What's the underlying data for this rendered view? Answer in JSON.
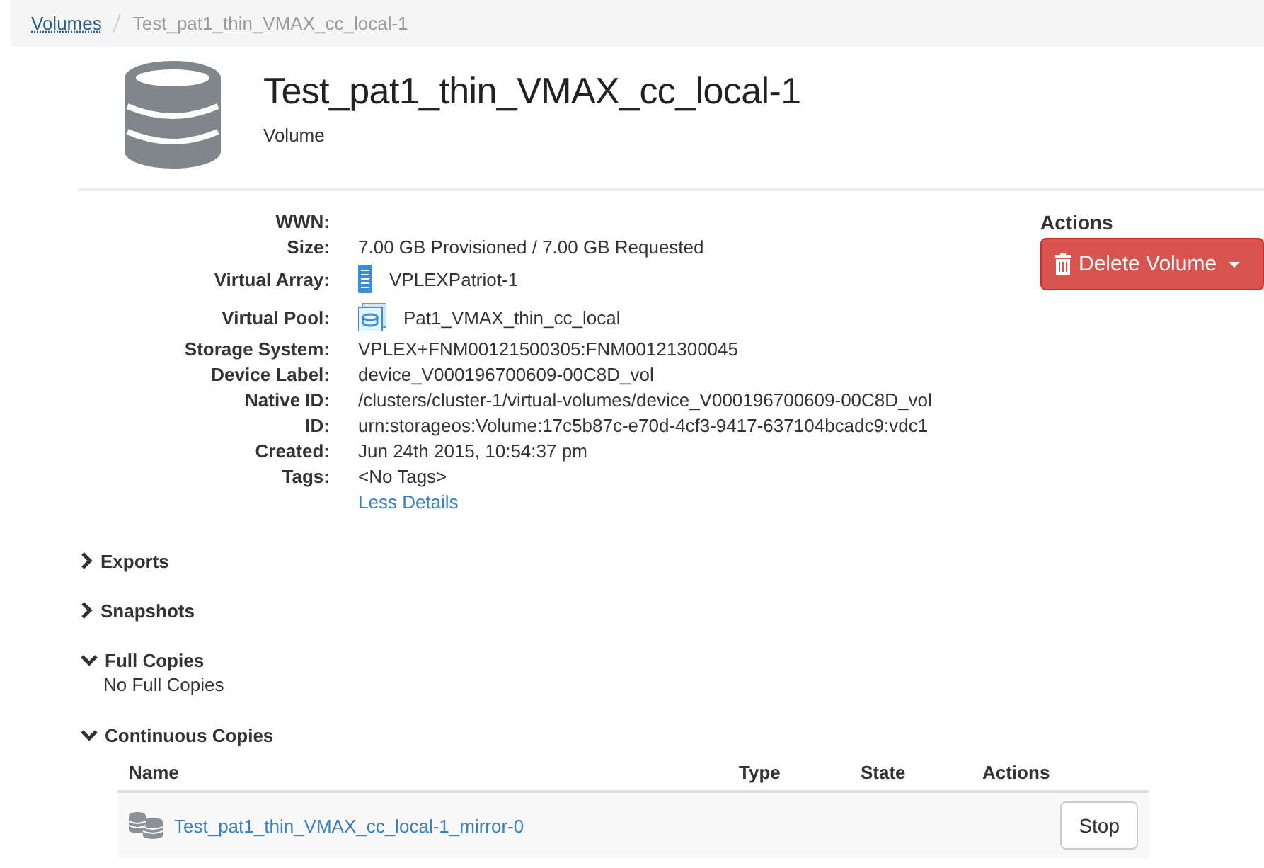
{
  "breadcrumb": [
    {
      "label": "Volumes",
      "kind": "link"
    },
    {
      "label": "Test_pat1_thin_VMAX_cc_local-1",
      "kind": "current"
    }
  ],
  "header": {
    "title": "Test_pat1_thin_VMAX_cc_local-1",
    "subtitle": "Volume"
  },
  "details": [
    {
      "label": "WWN:",
      "kind": "text"
    },
    {
      "label": "Size:",
      "value": "7.00 GB Provisioned / 7.00 GB Requested",
      "kind": "text"
    },
    {
      "label": "Virtual Array:",
      "value": "VPLEXPatriot-1",
      "kind": "array"
    },
    {
      "label": "Virtual Pool:",
      "value": "Pat1_VMAX_thin_cc_local",
      "kind": "pool"
    },
    {
      "label": "Storage System:",
      "value": "VPLEX+FNM00121500305:FNM00121300045",
      "kind": "text"
    },
    {
      "label": "Device Label:",
      "value": "device_V000196700609-00C8D_vol",
      "kind": "text"
    },
    {
      "label": "Native ID:",
      "value": "/clusters/cluster-1/virtual-volumes/device_V000196700609-00C8D_vol",
      "kind": "text"
    },
    {
      "label": "ID:",
      "value": "urn:storageos:Volume:17c5b87c-e70d-4cf3-9417-637104bcadc9:vdc1",
      "kind": "text"
    },
    {
      "label": "Created:",
      "value": "Jun 24th 2015, 10:54:37 pm",
      "kind": "text"
    },
    {
      "label": "Tags:",
      "value": "<No Tags>",
      "kind": "text"
    }
  ],
  "details_toggle": "Less Details",
  "actions": {
    "title": "Actions",
    "button": "Delete Volume"
  },
  "sections": [
    {
      "title": "Exports",
      "expanded": false
    },
    {
      "title": "Snapshots",
      "expanded": false
    },
    {
      "title": "Full Copies",
      "expanded": true,
      "empty_text": "No Full Copies"
    },
    {
      "title": "Continuous Copies",
      "expanded": true,
      "table": {
        "columns": [
          "Name",
          "Type",
          "State",
          "Actions"
        ],
        "rows": [
          {
            "name": "Test_pat1_thin_VMAX_cc_local-1_mirror-0",
            "action": "Stop"
          }
        ]
      }
    }
  ]
}
